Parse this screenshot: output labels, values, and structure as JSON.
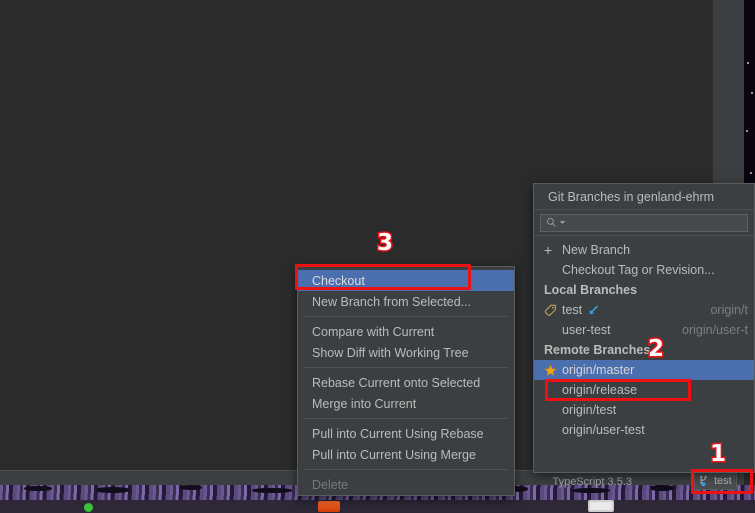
{
  "ide": {
    "status_bar": {
      "language_version": "TypeScript 3.5.3",
      "branch_widget_label": "test",
      "branch_widget_icon": "git-branch-icon"
    }
  },
  "git_popup": {
    "title": "Git Branches in genland-ehrm",
    "search": {
      "placeholder": "",
      "value": "",
      "icon": "search-icon"
    },
    "actions": [
      {
        "label": "New Branch",
        "icon": "plus-icon"
      },
      {
        "label": "Checkout Tag or Revision...",
        "icon": ""
      }
    ],
    "sections": [
      {
        "header": "Local Branches",
        "rows": [
          {
            "label": "test",
            "icon": "tag-icon",
            "badge": "incoming-arrow-icon",
            "tracking": "origin/t",
            "selected": false
          },
          {
            "label": "user-test",
            "icon": "",
            "badge": "",
            "tracking": "origin/user-t",
            "selected": false
          }
        ]
      },
      {
        "header": "Remote Branches",
        "rows": [
          {
            "label": "origin/master",
            "icon": "star-icon",
            "badge": "",
            "tracking": "",
            "selected": true
          },
          {
            "label": "origin/release",
            "icon": "",
            "badge": "",
            "tracking": "",
            "selected": false
          },
          {
            "label": "origin/test",
            "icon": "",
            "badge": "",
            "tracking": "",
            "selected": false
          },
          {
            "label": "origin/user-test",
            "icon": "",
            "badge": "",
            "tracking": "",
            "selected": false
          }
        ]
      }
    ]
  },
  "context_menu": {
    "groups": [
      {
        "items": [
          {
            "label": "Checkout",
            "selected": true,
            "disabled": false
          },
          {
            "label": "New Branch from Selected...",
            "selected": false,
            "disabled": false
          }
        ]
      },
      {
        "items": [
          {
            "label": "Compare with Current",
            "selected": false,
            "disabled": false
          },
          {
            "label": "Show Diff with Working Tree",
            "selected": false,
            "disabled": false
          }
        ]
      },
      {
        "items": [
          {
            "label": "Rebase Current onto Selected",
            "selected": false,
            "disabled": false
          },
          {
            "label": "Merge into Current",
            "selected": false,
            "disabled": false
          }
        ]
      },
      {
        "items": [
          {
            "label": "Pull into Current Using Rebase",
            "selected": false,
            "disabled": false
          },
          {
            "label": "Pull into Current Using Merge",
            "selected": false,
            "disabled": false
          }
        ]
      },
      {
        "items": [
          {
            "label": "Delete",
            "selected": false,
            "disabled": true
          }
        ]
      }
    ]
  },
  "annotations": {
    "color": "#ee1111",
    "markers": [
      {
        "number": "1",
        "target": "branch-widget"
      },
      {
        "number": "2",
        "target": "origin-master-row"
      },
      {
        "number": "3",
        "target": "checkout-menu-item"
      }
    ]
  },
  "colors": {
    "accent_selection": "#4b6eaf",
    "panel_bg": "#3c3f41",
    "editor_bg": "#2b2b2b",
    "text": "#bbbbbb",
    "annotation": "#ee1111"
  }
}
